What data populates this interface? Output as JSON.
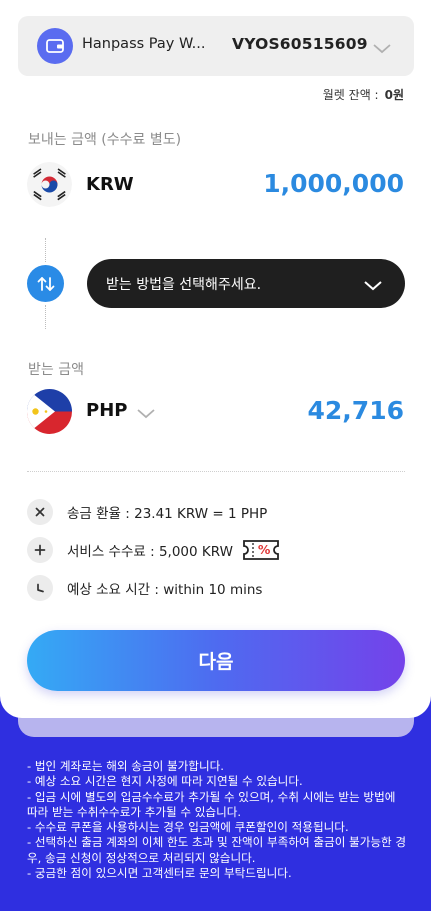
{
  "wallet": {
    "name": "Hanpass Pay W...",
    "id": "VYOS60515609",
    "balance_label": "월렛 잔액 :",
    "balance_value": "0원"
  },
  "send": {
    "label": "보내는 금액 (수수료 별도)",
    "currency": "KRW",
    "amount": "1,000,000"
  },
  "method": {
    "placeholder": "받는 방법을 선택해주세요."
  },
  "receive": {
    "label": "받는 금액",
    "currency": "PHP",
    "amount": "42,716"
  },
  "info": {
    "rate": "송금 환율 : 23.41 KRW = 1 PHP",
    "fee": "서비스 수수료 : 5,000 KRW",
    "time": "예상 소요 시간 : within 10 mins",
    "coupon_symbol": "%"
  },
  "next_button": "다음",
  "notices": [
    "- 법인 계좌로는 해외 송금이 불가합니다.",
    "- 예상 소요 시간은 현지 사정에 따라 지연될 수 있습니다.",
    "- 입금 시에 별도의 입금수수료가 추가될 수 있으며, 수취 시에는 받는 방법에 따라 받는 수취수수료가 추가될 수 있습니다.",
    "- 수수료 쿠폰을 사용하시는 경우 입금액에 쿠폰할인이 적용됩니다.",
    "- 선택하신 출금 계좌의 이체 한도 초과 및 잔액이 부족하여 출금이 불가능한 경우, 송금 신청이 정상적으로 처리되지 않습니다.",
    "- 궁금한 점이 있으시면 고객센터로 문의 부탁드립니다."
  ],
  "colors": {
    "accent": "#2b8ae0",
    "background": "#2f2fe0",
    "dark_select": "#1f1f1f"
  }
}
